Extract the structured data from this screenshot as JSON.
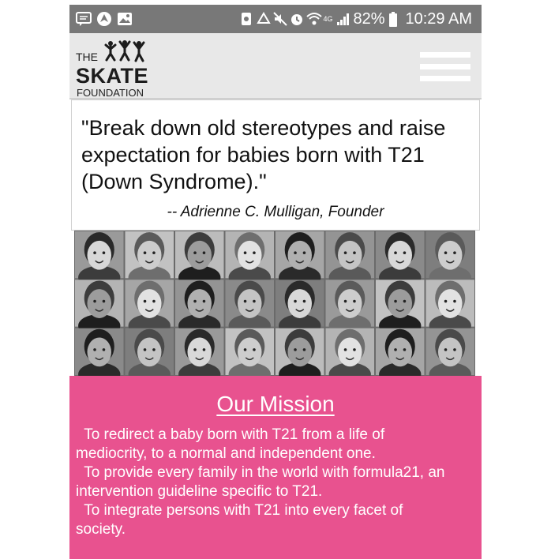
{
  "status_bar": {
    "left_icons": [
      "message-icon",
      "navigation-icon",
      "image-icon"
    ],
    "right_icons": [
      "nfc-icon",
      "recycle-icon",
      "mute-icon",
      "alarm-icon",
      "wifi-icon",
      "signal-icon",
      "battery-icon"
    ],
    "network_label": "4G",
    "battery": "82%",
    "time": "10:29 AM"
  },
  "header": {
    "logo": {
      "the": "THE",
      "skate": "SKATE",
      "foundation": "FOUNDATION"
    },
    "menu_icon": "hamburger-menu-icon"
  },
  "quote": {
    "text": " \"Break down old stereotypes and raise expectation for babies born with T21 (Down Syndrome).\"",
    "attribution": "-- Adrienne C. Mulligan, Founder"
  },
  "photo_grid": {
    "rows": 3,
    "columns": 8
  },
  "mission": {
    "title": "Our Mission",
    "lines": [
      "  To redirect a baby born with T21 from a life of",
      "mediocrity, to a normal and independent one.",
      "  To provide every family in the world with formula21, an",
      "intervention guideline specific to T21.",
      "  To integrate persons with T21 into every facet of",
      "society."
    ]
  },
  "colors": {
    "status_bar": "#787878",
    "header": "#e8e8e8",
    "mission_bg": "#e8528f"
  }
}
